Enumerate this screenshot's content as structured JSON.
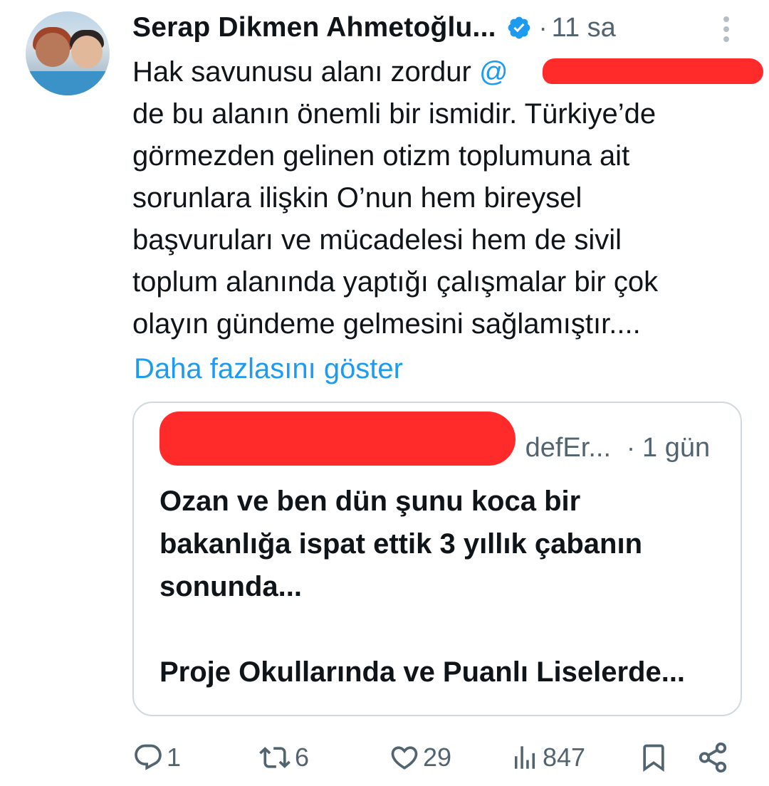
{
  "tweet": {
    "author": {
      "name": "Serap Dikmen Ahmetoğlu...",
      "avatar_icon": "profile-photo",
      "verified_icon": "verified-badge-icon",
      "verified_color": "#1d9bf0"
    },
    "separator": "·",
    "time": "11 sa",
    "more_icon": "more-vertical-icon",
    "body_lines": [
      "Hak savunusu alanı zordur ",
      "de bu alanın önemli bir ismidir. Türkiye’de",
      "görmezden gelinen otizm toplumuna ait",
      "sorunlara ilişkin O’nun hem bireysel",
      "başvuruları ve mücadelesi  hem de sivil",
      "toplum alanında yaptığı çalışmalar bir çok",
      "olayın gündeme gelmesini sağlamıştır...."
    ],
    "mention_prefix": "@",
    "show_more": "Daha fazlasını göster",
    "link_color": "#1d9bf0",
    "redaction_color": "#ff2b2b"
  },
  "quote": {
    "handle": "defEr...",
    "separator": "·",
    "time": "1 gün",
    "text_lines": [
      "Ozan ve ben dün şunu koca bir",
      "bakanlığa ispat ettik 3 yıllık çabanın",
      "sonunda...",
      "",
      "Proje Okullarında ve Puanlı Liselerde..."
    ]
  },
  "actions": {
    "reply": {
      "icon": "reply-icon",
      "count": "1"
    },
    "retweet": {
      "icon": "retweet-icon",
      "count": "6"
    },
    "like": {
      "icon": "heart-icon",
      "count": "29"
    },
    "views": {
      "icon": "views-icon",
      "count": "847"
    },
    "bookmark": {
      "icon": "bookmark-icon"
    },
    "share": {
      "icon": "share-icon"
    }
  }
}
